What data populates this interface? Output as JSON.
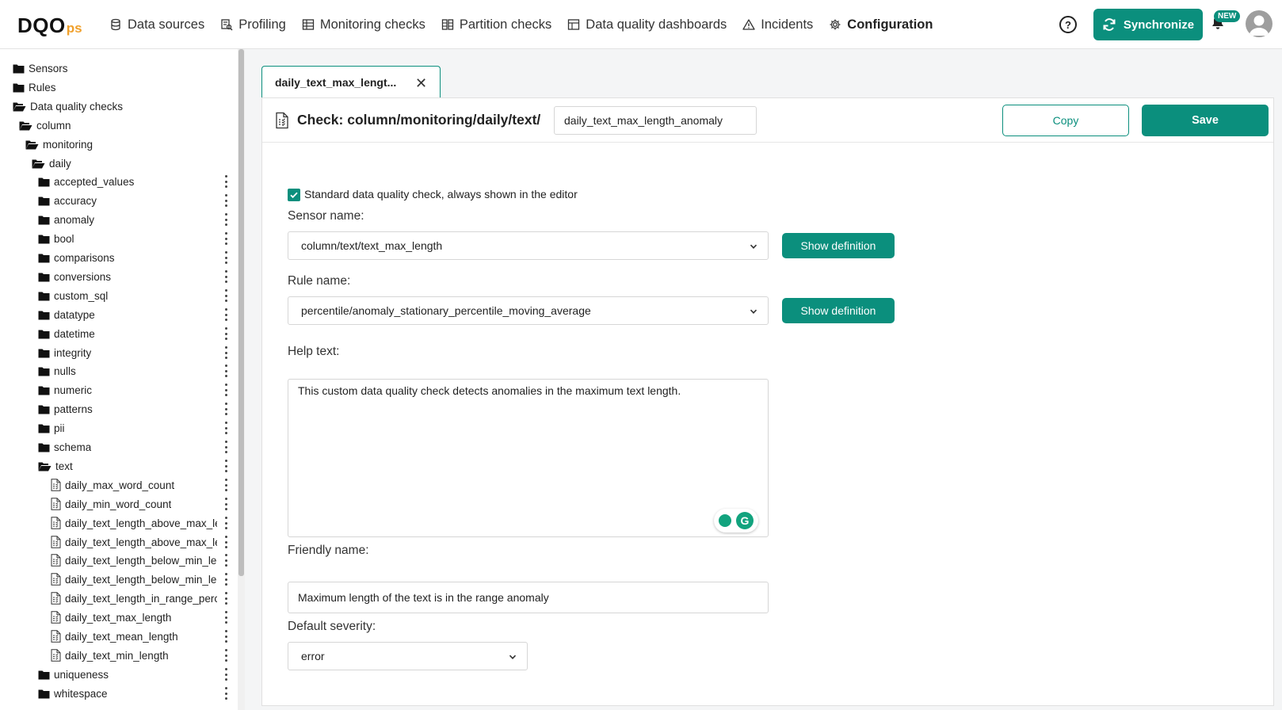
{
  "brand": {
    "main": "DQO",
    "sub": "ps"
  },
  "nav": [
    {
      "label": "Data sources",
      "icon": "database-icon"
    },
    {
      "label": "Profiling",
      "icon": "profiling-icon"
    },
    {
      "label": "Monitoring checks",
      "icon": "table-check-icon"
    },
    {
      "label": "Partition checks",
      "icon": "partition-icon"
    },
    {
      "label": "Data quality dashboards",
      "icon": "dashboard-icon"
    },
    {
      "label": "Incidents",
      "icon": "warning-icon"
    },
    {
      "label": "Configuration",
      "icon": "gear-icon",
      "active": true
    }
  ],
  "topbar": {
    "help": "?",
    "sync_label": "Synchronize",
    "new_badge": "NEW"
  },
  "tree": {
    "sensors": "Sensors",
    "rules": "Rules",
    "dq_checks": "Data quality checks",
    "column": "column",
    "monitoring": "monitoring",
    "daily": "daily",
    "categories_before": [
      "accepted_values",
      "accuracy",
      "anomaly",
      "bool",
      "comparisons",
      "conversions",
      "custom_sql",
      "datatype",
      "datetime",
      "integrity",
      "nulls",
      "numeric",
      "patterns",
      "pii",
      "schema"
    ],
    "text": "text",
    "text_checks": [
      "daily_max_word_count",
      "daily_min_word_count",
      "daily_text_length_above_max_ler",
      "daily_text_length_above_max_ler",
      "daily_text_length_below_min_len",
      "daily_text_length_below_min_len",
      "daily_text_length_in_range_perce",
      "daily_text_max_length",
      "daily_text_mean_length",
      "daily_text_min_length"
    ],
    "categories_after": [
      "uniqueness",
      "whitespace"
    ]
  },
  "tab": {
    "label": "daily_text_max_lengt...",
    "close": "✕"
  },
  "editor": {
    "title": "Check: column/monitoring/daily/text/",
    "check_name": "daily_text_max_length_anomaly",
    "copy_label": "Copy",
    "save_label": "Save",
    "standard_label": "Standard data quality check, always shown in the editor",
    "sensor_label": "Sensor name:",
    "sensor_value": "column/text/text_max_length",
    "rule_label": "Rule name:",
    "rule_value": "percentile/anomaly_stationary_percentile_moving_average",
    "show_definition": "Show definition",
    "help_label": "Help text:",
    "help_value": "This custom data quality check detects anomalies in the maximum text length.",
    "friendly_label": "Friendly name:",
    "friendly_value": "Maximum length of the text is in the range anomaly",
    "severity_label": "Default severity:",
    "severity_value": "error"
  },
  "colors": {
    "accent": "#0b8f7d",
    "logo_sub": "#f0a02b"
  }
}
